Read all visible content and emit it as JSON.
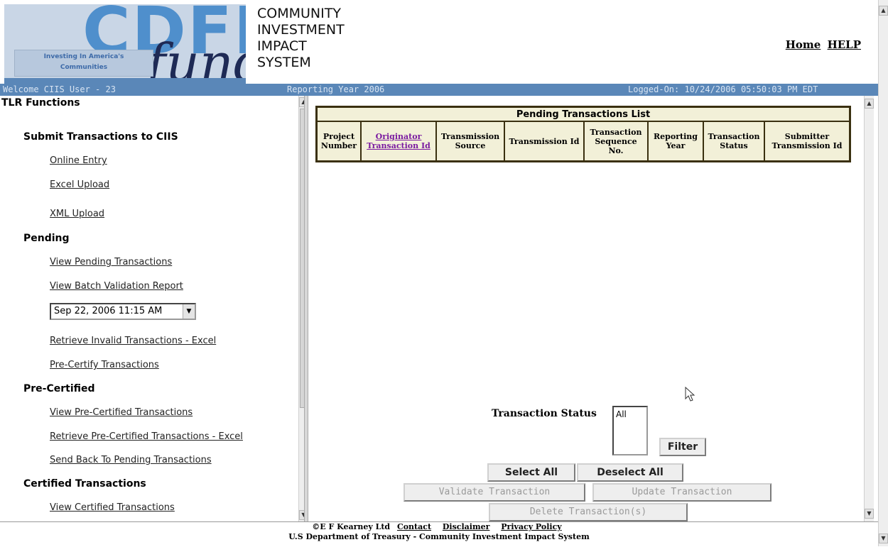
{
  "header": {
    "logo_letters": "CDFI",
    "logo_script": "fund",
    "logo_tagline": [
      "Investing In America's",
      "Communities"
    ],
    "system_title": [
      "COMMUNITY",
      "INVESTMENT",
      "IMPACT",
      "SYSTEM"
    ],
    "home_link": "Home",
    "help_link": "HELP"
  },
  "status_bar": {
    "welcome": "Welcome CIIS User - 23",
    "reporting_year": "Reporting Year 2006",
    "logged_on": "Logged-On: 10/24/2006 05:50:03 PM EDT"
  },
  "sidebar": {
    "title": "TLR Functions",
    "submit_section": "Submit Transactions to CIIS",
    "online_entry": "Online Entry",
    "excel_upload": "Excel Upload",
    "xml_upload": "XML Upload",
    "pending_section": "Pending",
    "view_pending": "View Pending Transactions",
    "view_batch": "View Batch Validation Report",
    "batch_date": "Sep 22, 2006 11:15 AM",
    "retrieve_invalid": "Retrieve Invalid Transactions - Excel",
    "pre_certify": "Pre-Certify Transactions",
    "precertified_section": "Pre-Certified",
    "view_precertified": "View Pre-Certified Transactions",
    "retrieve_precertified": "Retrieve Pre-Certified Transactions - Excel",
    "send_back": "Send Back To Pending Transactions",
    "certified_section": "Certified Transactions",
    "view_certified": "View Certified Transactions"
  },
  "table": {
    "caption": "Pending Transactions List",
    "columns": [
      "Project Number",
      "Originator Transaction Id",
      "Transmission Source",
      "Transmission Id",
      "Transaction Sequence No.",
      "Reporting Year",
      "Transaction Status",
      "Submitter Transmission Id"
    ]
  },
  "filter": {
    "label": "Transaction Status",
    "options": [
      "All"
    ],
    "filter_button": "Filter"
  },
  "actions": {
    "select_all": "Select All",
    "deselect_all": "Deselect All",
    "validate": "Validate Transaction",
    "update": "Update Transaction",
    "delete": "Delete Transaction(s)"
  },
  "footer": {
    "copyright": "©E F Kearney Ltd",
    "contact": "Contact",
    "disclaimer": "Disclaimer",
    "privacy": "Privacy Policy",
    "line2": "U.S Department of Treasury - Community Investment Impact System"
  }
}
